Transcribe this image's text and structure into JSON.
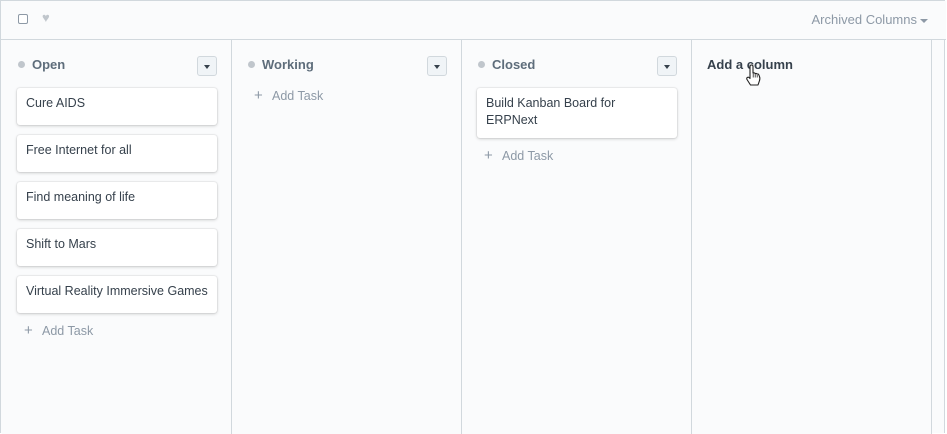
{
  "toolbar": {
    "archived_label": "Archived Columns",
    "select_all_checked": false,
    "liked": false
  },
  "columns": [
    {
      "title": "Open",
      "dot_color": "#c0c6cc",
      "cards": [
        "Cure AIDS",
        "Free Internet for all",
        "Find meaning of life",
        "Shift to Mars",
        "Virtual Reality Immersive Games"
      ],
      "add_task_label": "Add Task"
    },
    {
      "title": "Working",
      "dot_color": "#c0c6cc",
      "cards": [],
      "add_task_label": "Add Task"
    },
    {
      "title": "Closed",
      "dot_color": "#c0c6cc",
      "cards": [
        "Build Kanban Board for ERPNext"
      ],
      "add_task_label": "Add Task"
    }
  ],
  "add_column_label": "Add a column",
  "icons": {
    "checkbox": "checkbox-icon",
    "heart": "heart-icon",
    "caret": "caret-down-icon",
    "plus": "plus-icon",
    "cursor": "hand-pointer-icon"
  },
  "colors": {
    "card_text": "#36414c",
    "muted": "#8d99a6",
    "border": "#d1d8dd",
    "background": "#fafbfc"
  }
}
